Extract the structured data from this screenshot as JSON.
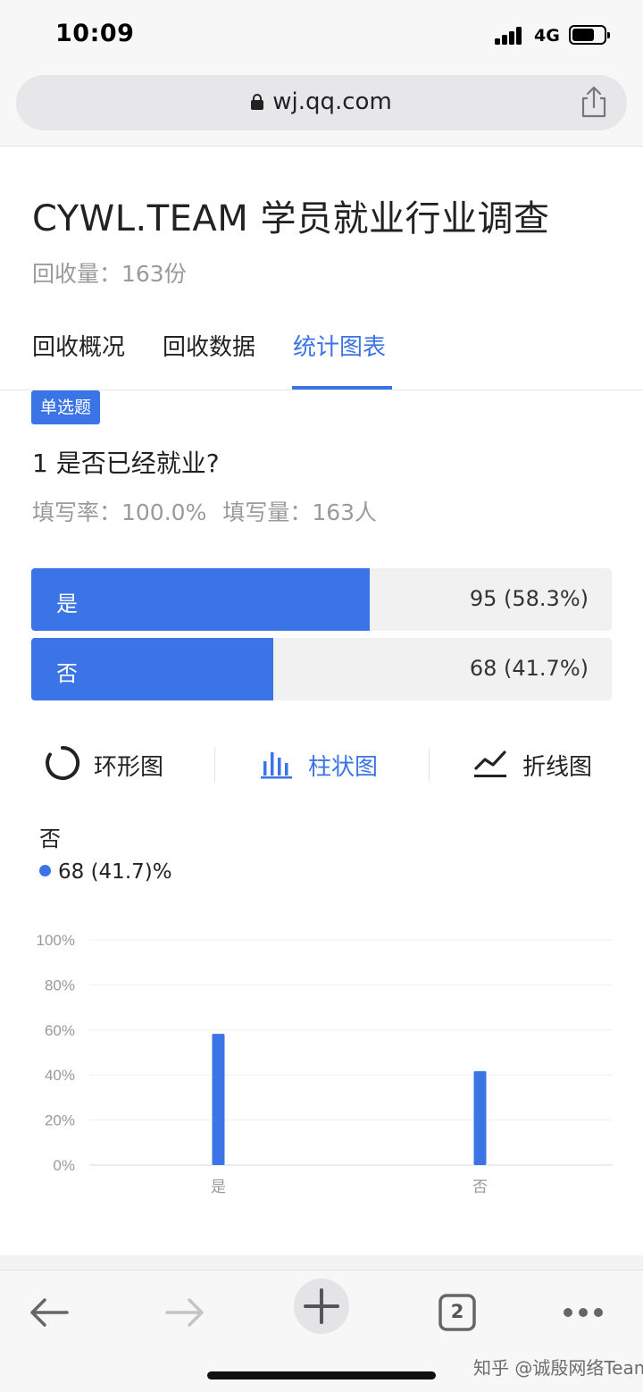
{
  "status_bar": {
    "time": "10:09",
    "network": "4G"
  },
  "browser": {
    "url": "wj.qq.com"
  },
  "page": {
    "title": "CYWL.TEAM 学员就业行业调查",
    "collect_count": "回收量：163份"
  },
  "tabs": [
    {
      "label": "回收概况",
      "active": false
    },
    {
      "label": "回收数据",
      "active": false
    },
    {
      "label": "统计图表",
      "active": true
    }
  ],
  "question": {
    "type_badge": "单选题",
    "title": "1 是否已经就业?",
    "fill_rate": "填写率：100.0%",
    "fill_count": "填写量：163人"
  },
  "options": [
    {
      "label": "是",
      "value_text": "95 (58.3%)",
      "percent": 58.3
    },
    {
      "label": "否",
      "value_text": "68 (41.7%)",
      "percent": 41.7
    }
  ],
  "chart_switch": {
    "items": [
      {
        "label": "环形图",
        "icon": "donut-chart-icon",
        "active": false
      },
      {
        "label": "柱状图",
        "icon": "bar-chart-icon",
        "active": true
      },
      {
        "label": "折线图",
        "icon": "line-chart-icon",
        "active": false
      }
    ]
  },
  "tooltip": {
    "title": "否",
    "value": "68 (41.7)%"
  },
  "chart_data": {
    "type": "bar",
    "categories": [
      "是",
      "否"
    ],
    "values": [
      58.3,
      41.7
    ],
    "ylim": [
      0,
      100
    ],
    "yticks": [
      "100%",
      "80%",
      "60%",
      "40%",
      "20%",
      "0%"
    ],
    "grid": true,
    "color": "#3b74e6"
  },
  "toolbar": {
    "tab_count": "2",
    "icons": [
      "back-arrow-icon",
      "forward-arrow-icon",
      "new-tab-plus-icon",
      "tabs-count-icon",
      "more-dots-icon"
    ]
  },
  "watermark": "知乎 @诚殷网络Team",
  "colors": {
    "accent": "#3b74e6",
    "muted_text": "#9a9a9a",
    "bar_track": "#f1f1f2"
  }
}
